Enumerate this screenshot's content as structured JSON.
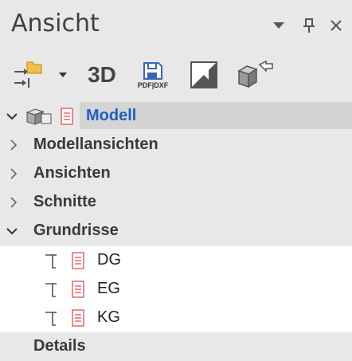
{
  "panel": {
    "title": "Ansicht",
    "controls": [
      "chevron-down-icon",
      "pin-icon",
      "close-icon"
    ]
  },
  "toolbar": {
    "view3d_label": "3D",
    "pdf_label": "PDF|DXF"
  },
  "tree": {
    "root": {
      "label": "Modell",
      "expanded": true,
      "color": "#1f5fbf"
    },
    "groups": [
      {
        "label": "Modellansichten",
        "expanded": false
      },
      {
        "label": "Ansichten",
        "expanded": false
      },
      {
        "label": "Schnitte",
        "expanded": false
      },
      {
        "label": "Grundrisse",
        "expanded": true
      }
    ],
    "floor_plans": [
      "DG",
      "EG",
      "KG"
    ],
    "details_label": "Details"
  }
}
